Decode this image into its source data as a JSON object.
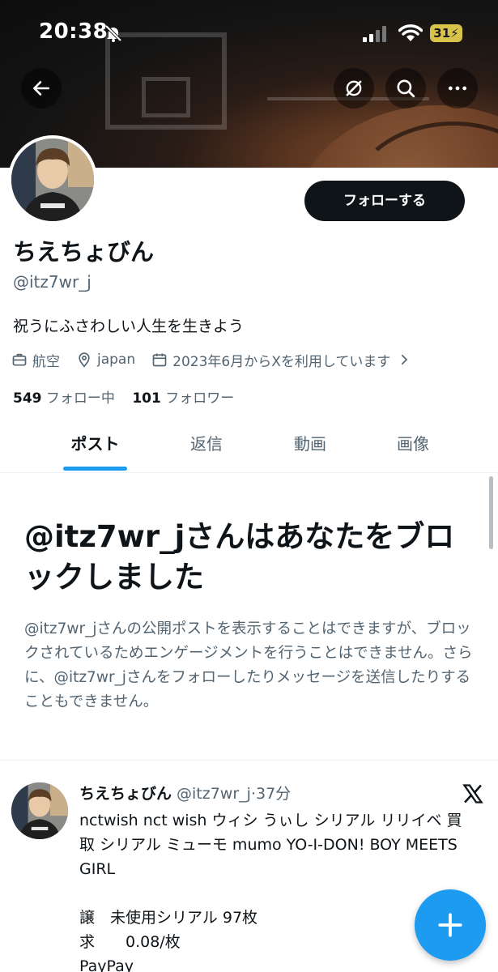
{
  "status_bar": {
    "time": "20:38",
    "battery": "31"
  },
  "profile": {
    "display_name": "ちえちょびん",
    "handle": "@itz7wr_j",
    "bio": "祝うにふさわしい人生を生きよう",
    "occupation": "航空",
    "location": "japan",
    "joined": "2023年6月からXを利用しています",
    "following_count": "549",
    "following_label": "フォロー中",
    "followers_count": "101",
    "followers_label": "フォロワー",
    "follow_button": "フォローする"
  },
  "tabs": [
    {
      "label": "ポスト",
      "active": true
    },
    {
      "label": "返信",
      "active": false
    },
    {
      "label": "動画",
      "active": false
    },
    {
      "label": "画像",
      "active": false
    }
  ],
  "blocked": {
    "title": "@itz7wr_jさんはあなたをブロックしました",
    "description": "@itz7wr_jさんの公開ポストを表示することはできますが、ブロックされているためエンゲージメントを行うことはできません。さらに、@itz7wr_jさんをフォローしたりメッセージを送信したりすることもできません。"
  },
  "post": {
    "author": "ちえちょびん",
    "handle_time": "@itz7wr_j·37分",
    "lines": [
      "nctwish nct wish ウィシ うぃし シリアル リリイベ 買取 シリアル ミューモ mumo YO-I-DON! BOY MEETS GIRL",
      "",
      "譲　未使用シリアル 97枚",
      "求　　0.08/枚",
      "PayPay"
    ]
  },
  "colors": {
    "accent": "#1d9bf0",
    "text": "#0f1419",
    "secondary": "#536471"
  },
  "icons": [
    "back-arrow-icon",
    "link-off-icon",
    "search-icon",
    "more-icon",
    "briefcase-icon",
    "location-pin-icon",
    "calendar-icon",
    "chevron-right-icon",
    "x-logo-icon",
    "plus-icon"
  ]
}
